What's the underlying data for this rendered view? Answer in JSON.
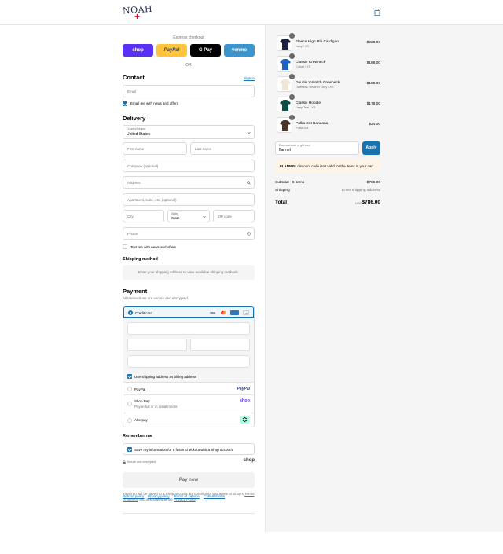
{
  "header": {
    "logo_text": "NOAH",
    "logo_mark": "+",
    "cart_icon": "shopping-bag-icon"
  },
  "express": {
    "title": "Express checkout",
    "buttons": [
      {
        "label": "shop",
        "bg": "#5a31f4",
        "color": "#ffffff"
      },
      {
        "label": "PayPal",
        "bg": "#ffc439",
        "color": "#253b80"
      },
      {
        "label": "G Pay",
        "bg": "#000000",
        "color": "#ffffff"
      },
      {
        "label": "venmo",
        "bg": "#3d95ce",
        "color": "#ffffff"
      }
    ],
    "or": "OR"
  },
  "contact": {
    "title": "Contact",
    "sign_in": "Sign in",
    "email_placeholder": "Email",
    "email_news": "Email me with news and offers"
  },
  "delivery": {
    "title": "Delivery",
    "country_label": "Country/Region",
    "country_value": "United States",
    "first_name": "First name",
    "last_name": "Last name",
    "company": "Company (optional)",
    "address": "Address",
    "apartment": "Apartment, suite, etc. (optional)",
    "city": "City",
    "state_label": "State",
    "state_value": "State",
    "zip": "ZIP code",
    "phone": "Phone",
    "text_news": "Text me with news and offers"
  },
  "shipping_method": {
    "title": "Shipping method",
    "note": "Enter your shipping address to view available shipping methods."
  },
  "payment": {
    "title": "Payment",
    "subtitle": "All transactions are secure and encrypted.",
    "credit_card": "Credit card",
    "card_brands": [
      "VISA",
      "MC",
      "AMEX",
      "+5"
    ],
    "use_shipping": "Use shipping address as billing address",
    "paypal": "PayPal",
    "shop_pay": "Shop Pay",
    "shop_pay_sub": "Pay in full or in installments",
    "afterpay": "Afterpay"
  },
  "remember": {
    "title": "Remember me",
    "save_info": "Save my information for a faster checkout with a Shop account",
    "secure": "Secure and encrypted",
    "shop_logo": "shop"
  },
  "pay_now": "Pay now",
  "legal": {
    "line1": "Your info will be saved to a Shop account. By continuing, you agree to Shop's",
    "tos": "Terms of Service",
    "and": "and acknowledge the",
    "privacy": "Privacy Policy",
    "period": "."
  },
  "footer": {
    "links": [
      "Refund policy",
      "Privacy policy",
      "Terms of service",
      "Cancellations"
    ]
  },
  "order": {
    "items": [
      {
        "name": "Fleece High Rib Cardigan",
        "variant": "Navy / XS",
        "price": "$228.00",
        "qty": "1",
        "color": "#1c2340"
      },
      {
        "name": "Classic Crewneck",
        "variant": "Cobalt / XS",
        "price": "$168.00",
        "qty": "1",
        "color": "#1f62c4"
      },
      {
        "name": "Double V-Notch Crewneck",
        "variant": "Oatmeal / Heather Grey / XS",
        "price": "$188.00",
        "qty": "1",
        "color": "#efe6d8"
      },
      {
        "name": "Classic Hoodie",
        "variant": "Deep Teal / XS",
        "price": "$178.00",
        "qty": "1",
        "color": "#0f4f4a"
      },
      {
        "name": "Polka Dot Bandana",
        "variant": "Polka Dot",
        "price": "$24.00",
        "qty": "1",
        "color": "#4a3328"
      }
    ],
    "discount_label": "Discount code or gift card",
    "discount_value": "flannel",
    "apply": "Apply",
    "error_code": "FLANNEL",
    "error_text": "discount code isn't valid for the items in your cart",
    "subtotal_label": "Subtotal · 5 items",
    "subtotal_value": "$786.00",
    "shipping_label": "Shipping",
    "shipping_value": "Enter shipping address",
    "total_label": "Total",
    "currency": "USD",
    "total_value": "$786.00"
  }
}
